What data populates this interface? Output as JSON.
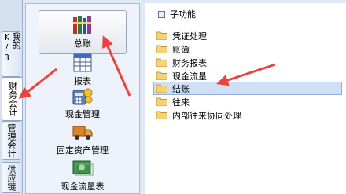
{
  "tabs": [
    {
      "label": "我的K/3"
    },
    {
      "label": "财务会计"
    },
    {
      "label": "管理会计"
    },
    {
      "label": "供应链"
    }
  ],
  "modules": [
    {
      "label": "总账",
      "icon": "ledger-books-icon"
    },
    {
      "label": "报表",
      "icon": "spreadsheet-icon"
    },
    {
      "label": "现金管理",
      "icon": "cash-calculator-icon"
    },
    {
      "label": "固定资产管理",
      "icon": "delivery-truck-icon"
    },
    {
      "label": "现金流量表",
      "icon": "cash-flow-icon"
    }
  ],
  "tree": {
    "title": "子功能",
    "items": [
      {
        "label": "凭证处理"
      },
      {
        "label": "账簿"
      },
      {
        "label": "财务报表"
      },
      {
        "label": "现金流量"
      },
      {
        "label": "结账"
      },
      {
        "label": "往来"
      },
      {
        "label": "内部往来协同处理"
      }
    ]
  },
  "colors": {
    "arrow": "#e8443f",
    "folder": "#f3d27a",
    "selection": "#cfdff5"
  }
}
